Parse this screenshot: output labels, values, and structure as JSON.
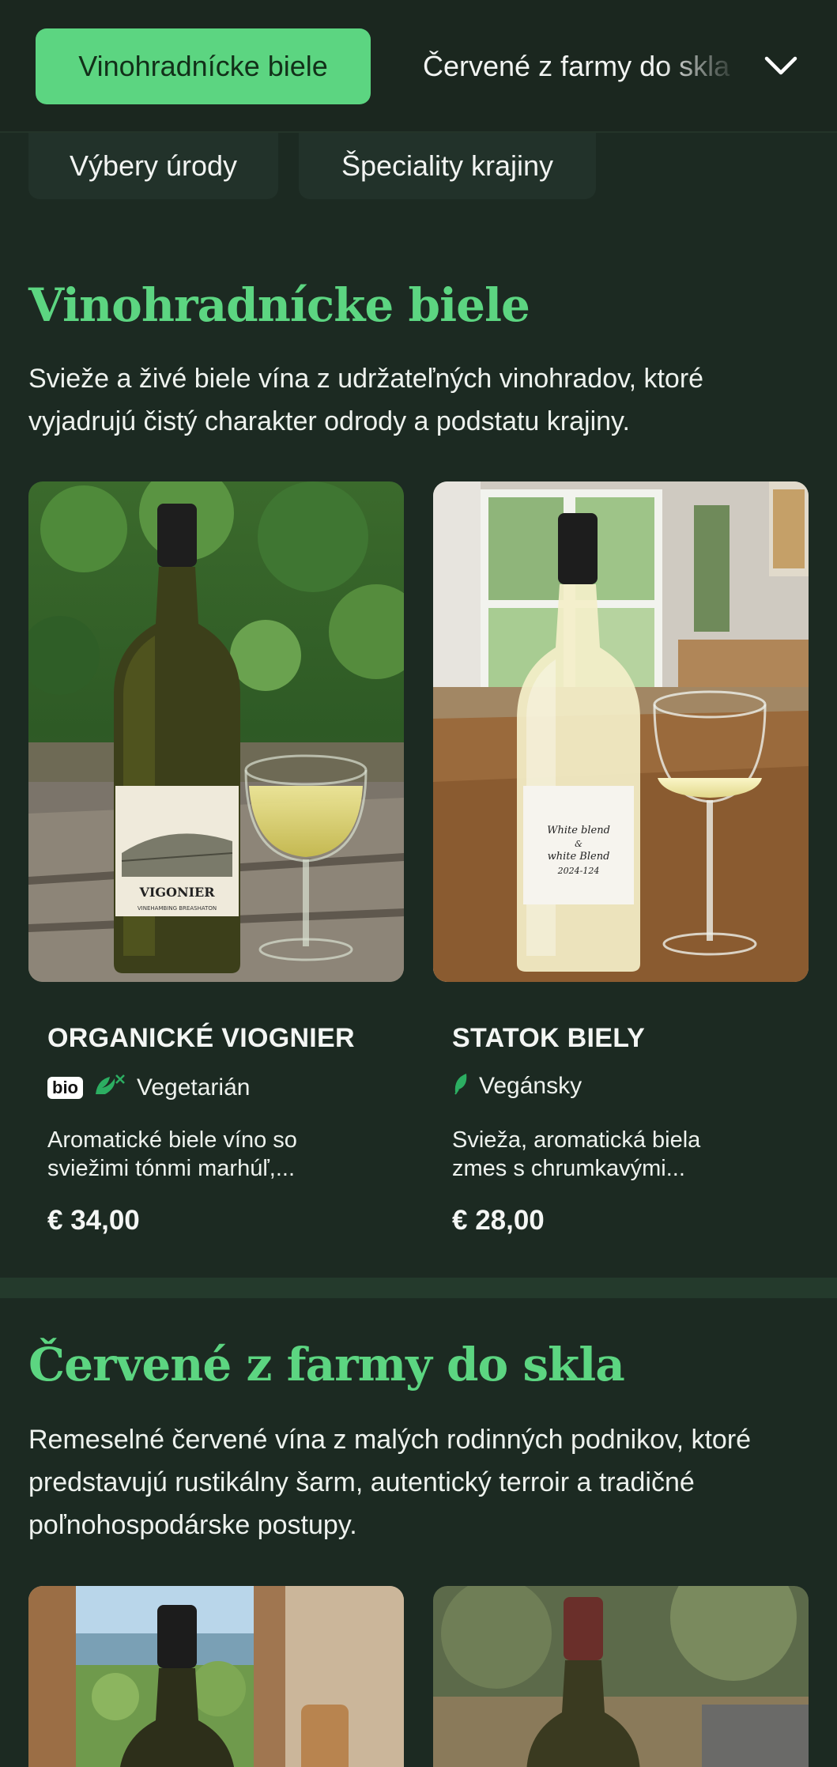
{
  "nav": {
    "active_category": "Vinohradnícke biele",
    "next_category": "Červené z farmy do skla",
    "row2": [
      "Výbery úrody",
      "Špeciality krajiny"
    ]
  },
  "section1": {
    "title": "Vinohradnícke biele",
    "description": "Svieže a živé biele vína z udržateľných vinohradov, ktoré vyjadrujú čistý charakter odrody a podstatu krajiny.",
    "products": [
      {
        "name": "ORGANICKÉ VIOGNIER",
        "badge": "bio",
        "tag": "Vegetarián",
        "description": "Aromatické biele víno so sviežimi tónmi marhúľ,...",
        "price": "€ 34,00",
        "label_text": "VIGONIER",
        "label_sub": "VINEHAMBING BREASHATON"
      },
      {
        "name": "STATOK BIELY",
        "tag": "Vegánsky",
        "description": "Svieža, aromatická biela zmes s chrumkavými...",
        "price": "€ 28,00",
        "label_text": "White blend & white Blend 2024-124"
      }
    ]
  },
  "section2": {
    "title": "Červené z farmy do skla",
    "description": "Remeselné červené vína z malých rodinných podnikov, ktoré predstavujú rustikálny šarm, autentický terroir a tradičné poľnohospodárske postupy."
  },
  "colors": {
    "background": "#1c2a22",
    "accent": "#5cd581",
    "pill": "#22322a"
  }
}
